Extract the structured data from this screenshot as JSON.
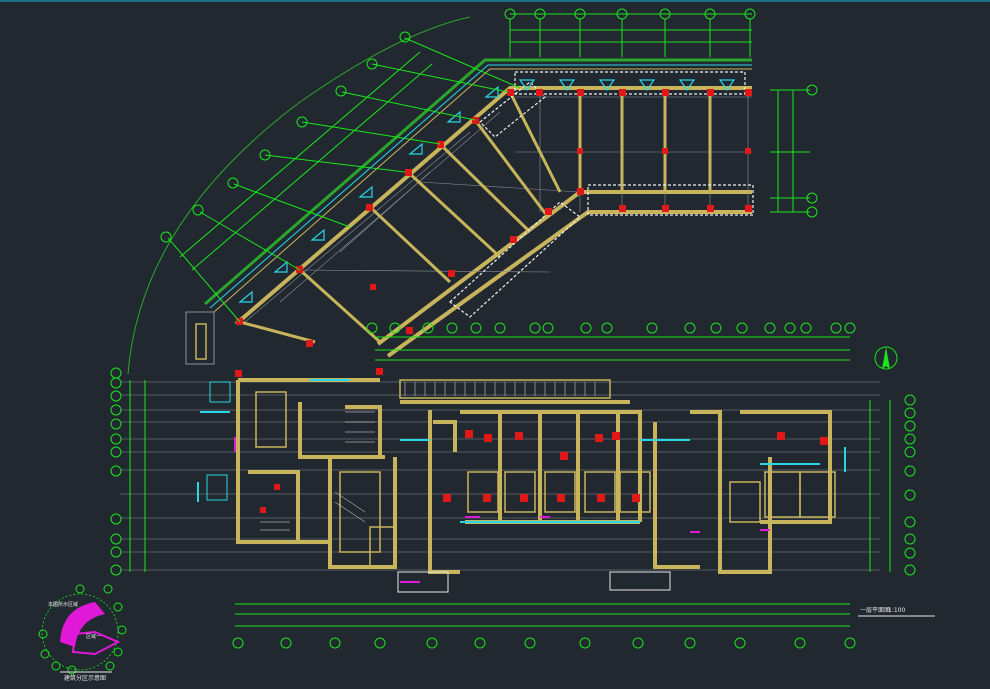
{
  "viewport": {
    "background": "#212830",
    "colors": {
      "axis_green": "#19e619",
      "wall_yellow": "#c8b45a",
      "column_red": "#e01818",
      "glass_cyan": "#29d6e6",
      "dim_white": "#e8e8e8",
      "grid_gray": "#8a8f96",
      "dashed_white": "#f0f0f0",
      "magenta": "#e018d8",
      "outline_green": "#2aa62a"
    }
  },
  "drawing": {
    "sheet_title": "一层平面图",
    "scale": "1:100",
    "north_arrow_icon": "north-arrow-icon",
    "keyplan_title": "建筑分区示意图",
    "keyplan_note": "本图所示区域",
    "keyplan_label_a": "区域一"
  }
}
